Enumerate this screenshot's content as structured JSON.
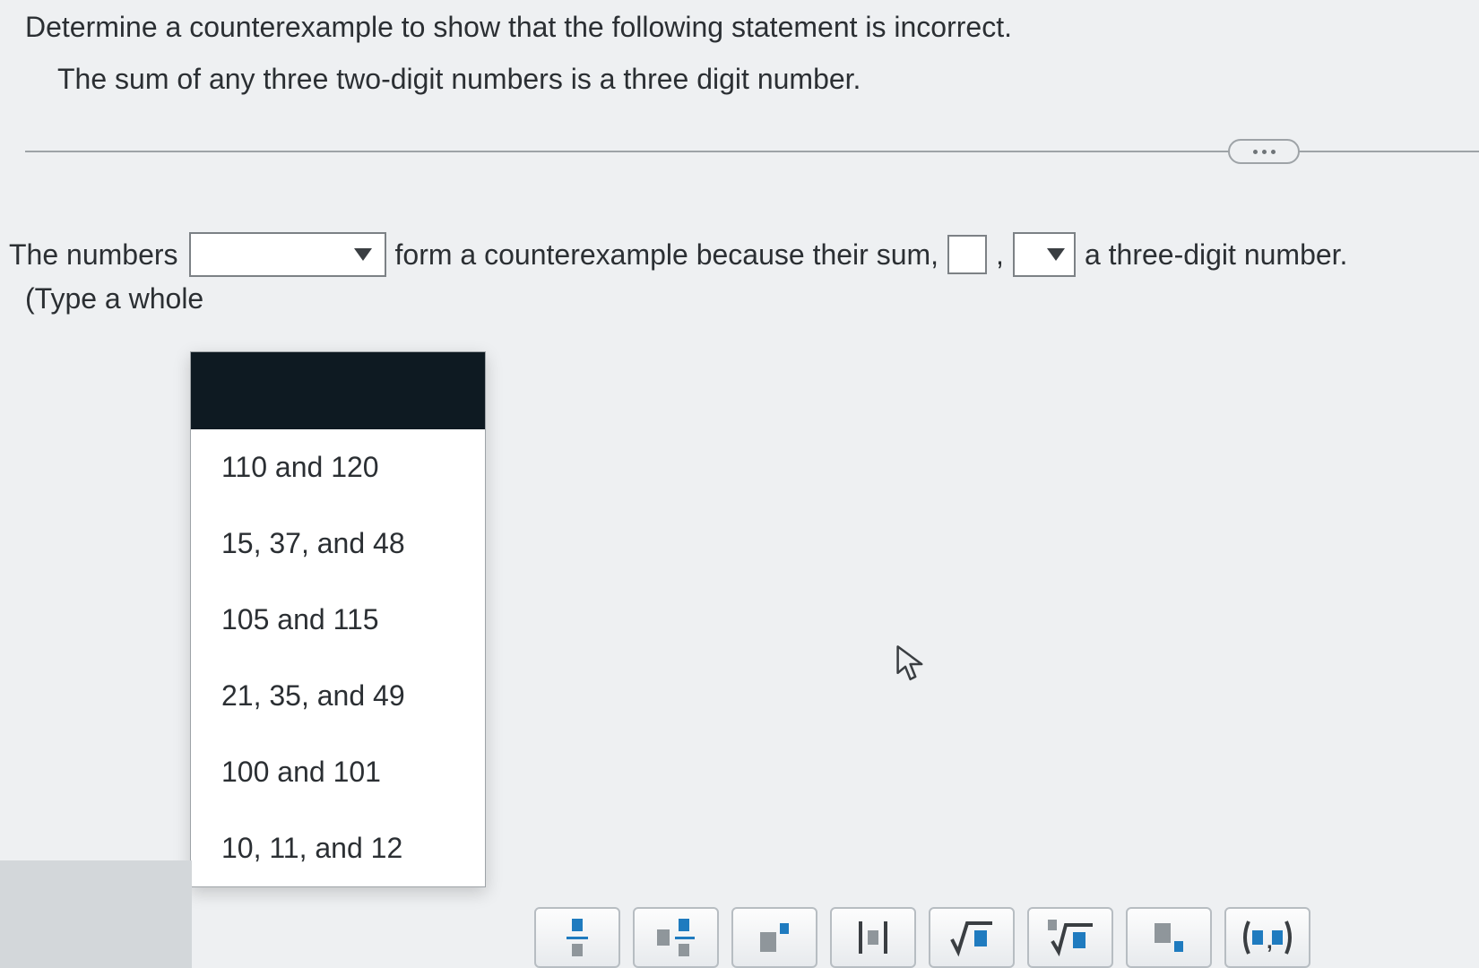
{
  "question": {
    "prompt": "Determine a counterexample to show that the following statement is incorrect.",
    "statement": "The sum of any three two-digit numbers is a three digit number."
  },
  "answer": {
    "lead": "The numbers",
    "mid": "form a counterexample because their sum,",
    "comma": ",",
    "tail": "a three-digit number.",
    "hint": "(Type a whole"
  },
  "dropdown1": {
    "options": [
      "110 and 120",
      "15, 37, and 48",
      "105 and 115",
      "21, 35, and 49",
      "100 and 101",
      "10, 11, and 12"
    ]
  },
  "toolbar": {
    "buttons": [
      "fraction",
      "mixed-fraction",
      "exponent",
      "absolute-value",
      "square-root",
      "nth-root",
      "subscript",
      "ordered-pair"
    ]
  }
}
